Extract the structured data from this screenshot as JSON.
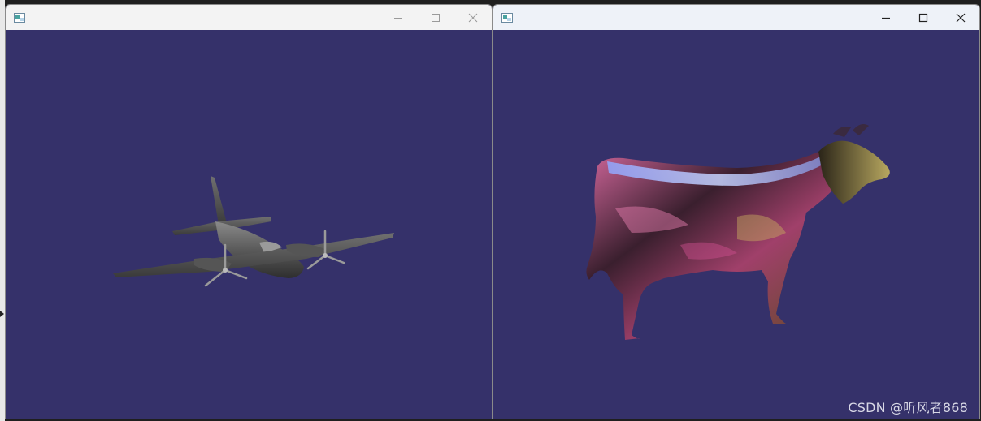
{
  "colors": {
    "viewport_bg": "#35316a",
    "titlebar_left": "#f3f3f3",
    "titlebar_right": "#eef2f8"
  },
  "windows": [
    {
      "id": "left",
      "icon": "app-window-icon",
      "controls": [
        "minimize-icon",
        "maximize-icon",
        "close-icon"
      ],
      "scene": "airplane-model"
    },
    {
      "id": "right",
      "icon": "app-window-icon",
      "controls": [
        "minimize-icon",
        "maximize-icon",
        "close-icon"
      ],
      "scene": "cow-model"
    }
  ],
  "watermark": {
    "text": "CSDN @听风者868"
  }
}
